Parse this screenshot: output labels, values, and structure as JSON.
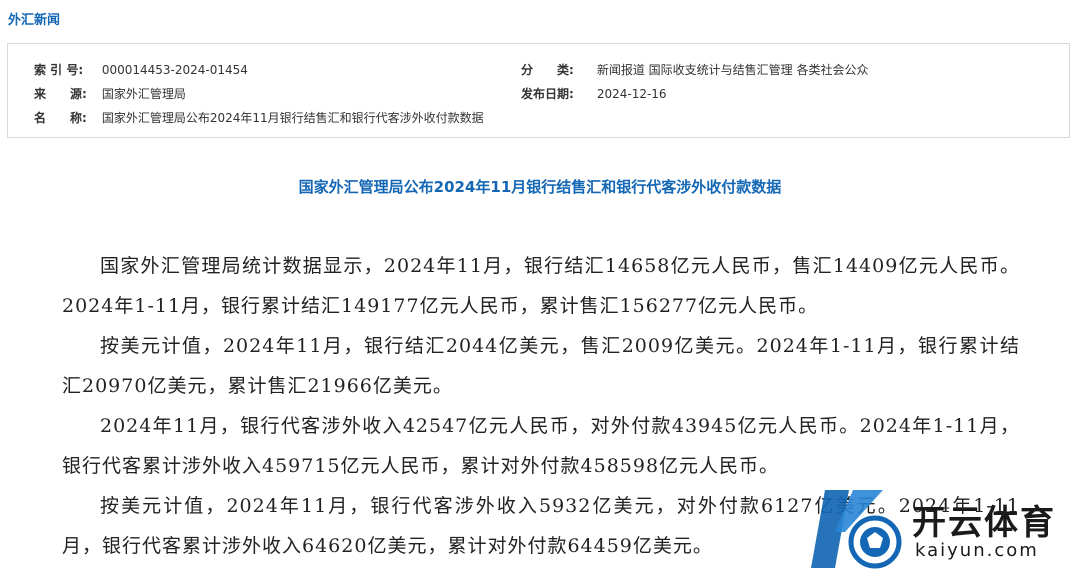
{
  "section_title": "外汇新闻",
  "meta": {
    "index_label": "索 引 号:",
    "index_value": "000014453-2024-01454",
    "category_label": "分　　类:",
    "category_value": "新闻报道  国际收支统计与结售汇管理  各类社会公众",
    "source_label": "来　　源:",
    "source_value": "国家外汇管理局",
    "date_label": "发布日期:",
    "date_value": "2024-12-16",
    "name_label": "名　　称:",
    "name_value": "国家外汇管理局公布2024年11月银行结售汇和银行代客涉外收付款数据"
  },
  "article": {
    "title": "国家外汇管理局公布2024年11月银行结售汇和银行代客涉外收付款数据",
    "paragraphs": [
      "国家外汇管理局统计数据显示，2024年11月，银行结汇14658亿元人民币，售汇14409亿元人民币。2024年1-11月，银行累计结汇149177亿元人民币，累计售汇156277亿元人民币。",
      "按美元计值，2024年11月，银行结汇2044亿美元，售汇2009亿美元。2024年1-11月，银行累计结汇20970亿美元，累计售汇21966亿美元。",
      "2024年11月，银行代客涉外收入42547亿元人民币，对外付款43945亿元人民币。2024年1-11月，银行代客累计涉外收入459715亿元人民币，累计对外付款458598亿元人民币。",
      "按美元计值，2024年11月，银行代客涉外收入5932亿美元，对外付款6127亿美元。2024年1-11月，银行代客累计涉外收入64620亿美元，累计对外付款64459亿美元。"
    ]
  },
  "watermark": {
    "brand": "开云体育",
    "url": "kaiyun.com",
    "logo_icon": "kaiyun-logo-icon",
    "colors": {
      "blue": "#1467b4",
      "dark": "#1a1a1a"
    }
  }
}
